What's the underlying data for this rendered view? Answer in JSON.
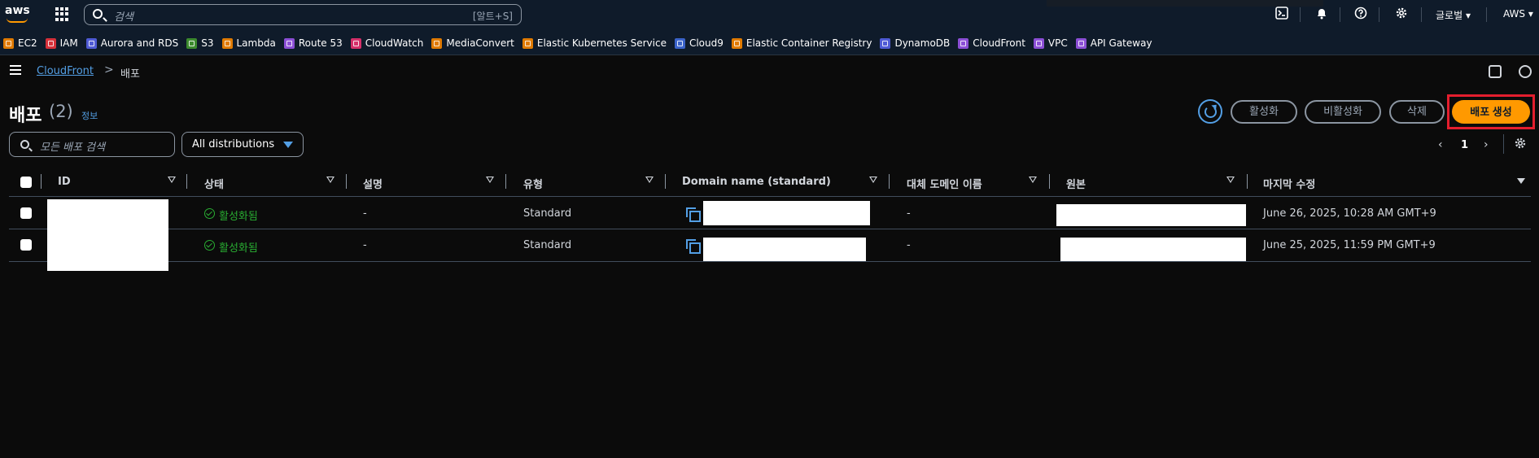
{
  "topnav": {
    "logo": "aws",
    "search_placeholder": "검색",
    "search_shortcut": "[알트+S]",
    "region": "글로벌",
    "account": "AWS",
    "icons": [
      "cloudshell-icon",
      "bell-icon",
      "help-icon",
      "gear-icon"
    ]
  },
  "favorites": [
    {
      "label": "EC2",
      "color": "#e07b00"
    },
    {
      "label": "IAM",
      "color": "#d6303a"
    },
    {
      "label": "Aurora and RDS",
      "color": "#4f5bd5"
    },
    {
      "label": "S3",
      "color": "#3c8a2e"
    },
    {
      "label": "Lambda",
      "color": "#e07b00"
    },
    {
      "label": "Route 53",
      "color": "#8c4fd6"
    },
    {
      "label": "CloudWatch",
      "color": "#d6306a"
    },
    {
      "label": "MediaConvert",
      "color": "#e07b00"
    },
    {
      "label": "Elastic Kubernetes Service",
      "color": "#e07b00"
    },
    {
      "label": "Cloud9",
      "color": "#3b63c9"
    },
    {
      "label": "Elastic Container Registry",
      "color": "#e07b00"
    },
    {
      "label": "DynamoDB",
      "color": "#4f5bd5"
    },
    {
      "label": "CloudFront",
      "color": "#8c4fd6"
    },
    {
      "label": "VPC",
      "color": "#8c4fd6"
    },
    {
      "label": "API Gateway",
      "color": "#8c4fd6"
    }
  ],
  "breadcrumb": {
    "link": "CloudFront",
    "separator": ">",
    "current": "배포"
  },
  "page": {
    "title": "배포",
    "count": "(2)",
    "info": "정보"
  },
  "actions": {
    "enable": "활성화",
    "disable": "비활성화",
    "delete": "삭제",
    "create": "배포 생성"
  },
  "filter": {
    "search_placeholder": "모든 배포 검색",
    "select_value": "All distributions"
  },
  "pagination": {
    "prev": "‹",
    "page": "1",
    "next": "›"
  },
  "table": {
    "columns": [
      "ID",
      "상태",
      "설명",
      "유형",
      "Domain name (standard)",
      "대체 도메인 이름",
      "원본",
      "마지막 수정"
    ],
    "rows": [
      {
        "status": "활성화됨",
        "description": "-",
        "type": "Standard",
        "alt_domain": "-",
        "last_modified": "June 26, 2025, 10:28 AM GMT+9"
      },
      {
        "status": "활성화됨",
        "description": "-",
        "type": "Standard",
        "alt_domain": "-",
        "last_modified": "June 25, 2025, 11:59 PM GMT+9"
      }
    ]
  },
  "colors": {
    "accent": "#ff9900",
    "link": "#539fe5",
    "success": "#29ad32",
    "highlight": "#e41e2e"
  }
}
